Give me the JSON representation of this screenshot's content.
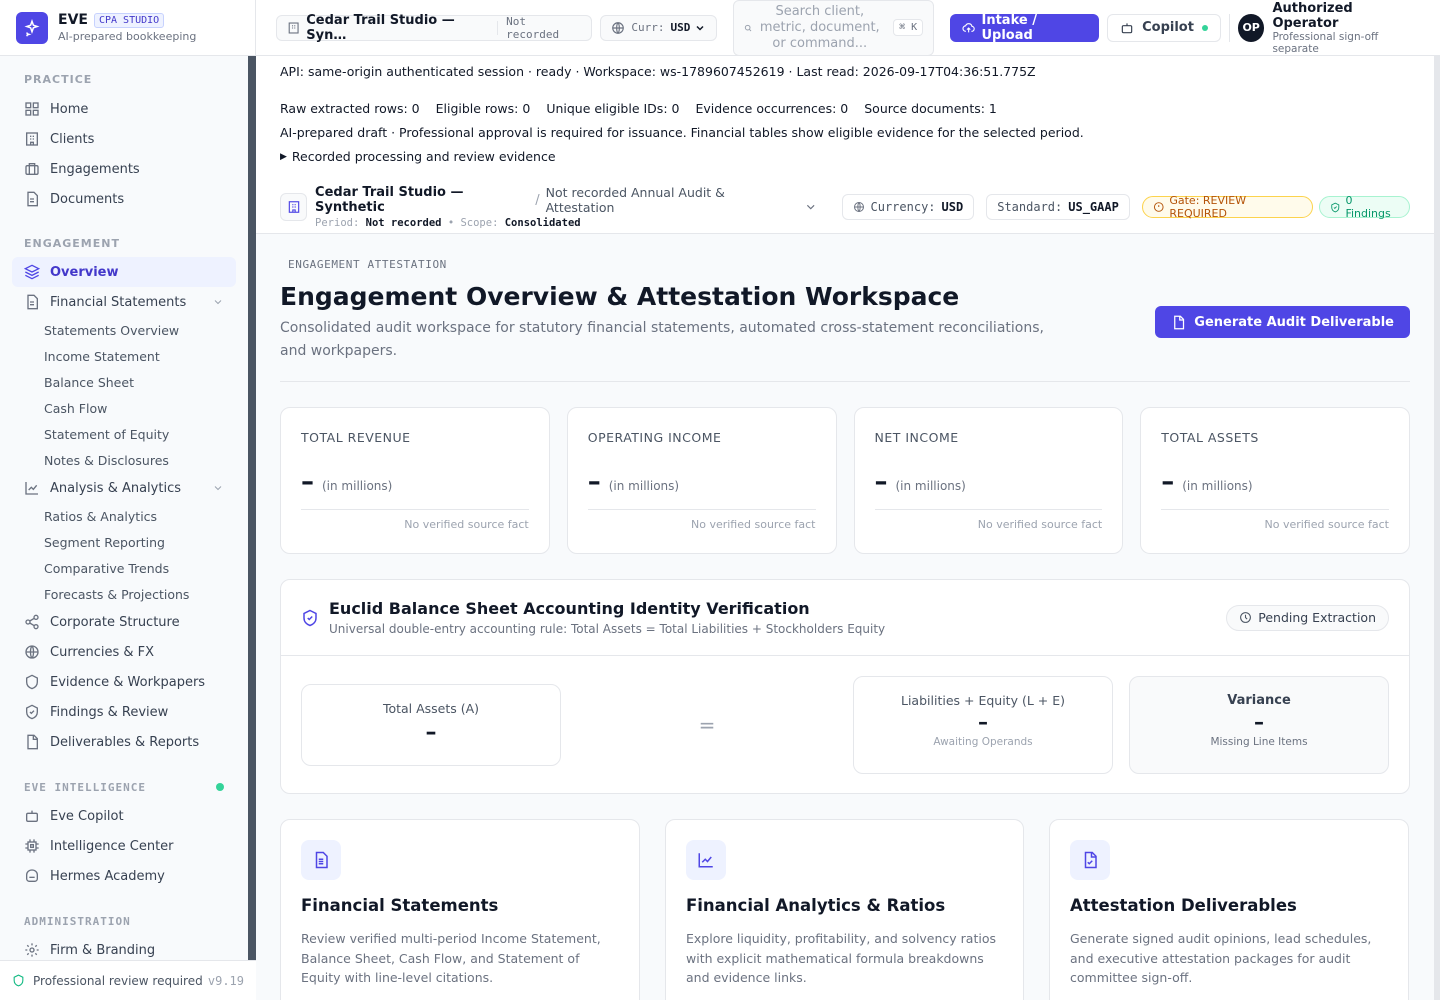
{
  "brand": {
    "name": "EVE",
    "badge": "CPA STUDIO",
    "tagline": "AI-prepared bookkeeping"
  },
  "sidebar": {
    "sections": {
      "practice": "PRACTICE",
      "engagement": "ENGAGEMENT",
      "intelligence": "EVE INTELLIGENCE",
      "admin": "ADMINISTRATION"
    },
    "practice": [
      {
        "label": "Home",
        "icon": "home-icon"
      },
      {
        "label": "Clients",
        "icon": "building-icon"
      },
      {
        "label": "Engagements",
        "icon": "briefcase-icon"
      },
      {
        "label": "Documents",
        "icon": "document-icon"
      }
    ],
    "engagement": {
      "overview": "Overview",
      "financial_statements": "Financial Statements",
      "fs_children": [
        "Statements Overview",
        "Income Statement",
        "Balance Sheet",
        "Cash Flow",
        "Statement of Equity",
        "Notes & Disclosures"
      ],
      "analysis": "Analysis & Analytics",
      "analysis_children": [
        "Ratios & Analytics",
        "Segment Reporting",
        "Comparative Trends",
        "Forecasts & Projections"
      ],
      "more": [
        {
          "label": "Corporate Structure",
          "icon": "share-icon"
        },
        {
          "label": "Currencies & FX",
          "icon": "globe-icon"
        },
        {
          "label": "Evidence & Workpapers",
          "icon": "shield-icon"
        },
        {
          "label": "Findings & Review",
          "icon": "shield-check-icon"
        },
        {
          "label": "Deliverables & Reports",
          "icon": "file-icon"
        }
      ]
    },
    "intelligence": [
      {
        "label": "Eve Copilot",
        "icon": "bot-icon"
      },
      {
        "label": "Intelligence Center",
        "icon": "cpu-icon"
      },
      {
        "label": "Hermes Academy",
        "icon": "academy-icon"
      }
    ],
    "admin": [
      {
        "label": "Firm & Branding",
        "icon": "gear-icon"
      }
    ],
    "footer": {
      "label": "Professional review required",
      "version": "v9.19"
    }
  },
  "topbar": {
    "client": "Cedar Trail Studio — Syn…",
    "client_status": "Not recorded",
    "currency_label": "Curr:",
    "currency_value": "USD",
    "search_placeholder": "Search client, metric, document, or command...",
    "search_kbd": "⌘ K",
    "intake_label": "Intake / Upload",
    "copilot_label": "Copilot",
    "user_initials": "OP",
    "user_name": "Authorized Operator",
    "user_role": "Professional sign-off separate"
  },
  "info": {
    "api": "API: same-origin authenticated session · ready · Workspace: ws-1789607452619 · Last read: 2026-09-17T04:36:51.775Z",
    "counts": [
      "Raw extracted rows: 0",
      "Eligible rows: 0",
      "Unique eligible IDs: 0",
      "Evidence occurrences: 0",
      "Source documents: 1"
    ],
    "draft_note": "AI-prepared draft · Professional approval is required for issuance. Financial tables show eligible evidence for the selected period.",
    "evidence_toggle": "Recorded processing and review evidence"
  },
  "context": {
    "client": "Cedar Trail Studio — Synthetic",
    "separator": "/",
    "engagement": "Not recorded Annual Audit & Attestation",
    "period_label": "Period:",
    "period_value": "Not recorded",
    "scope_label": "Scope:",
    "scope_value": "Consolidated",
    "currency_label": "Currency:",
    "currency_value": "USD",
    "standard_label": "Standard:",
    "standard_value": "US_GAAP",
    "gate": "Gate: REVIEW REQUIRED",
    "findings": "0 Findings"
  },
  "page": {
    "eyebrow": "ENGAGEMENT ATTESTATION",
    "title": "Engagement Overview & Attestation Workspace",
    "subtitle": "Consolidated audit workspace for statutory financial statements, automated cross-statement reconciliations, and workpapers.",
    "cta": "Generate Audit Deliverable"
  },
  "kpis": [
    {
      "label": "TOTAL REVENUE",
      "value": "–",
      "unit": "(in millions)",
      "foot": "No verified source fact"
    },
    {
      "label": "OPERATING INCOME",
      "value": "–",
      "unit": "(in millions)",
      "foot": "No verified source fact"
    },
    {
      "label": "NET INCOME",
      "value": "–",
      "unit": "(in millions)",
      "foot": "No verified source fact"
    },
    {
      "label": "TOTAL ASSETS",
      "value": "–",
      "unit": "(in millions)",
      "foot": "No verified source fact"
    }
  ],
  "identity": {
    "title": "Euclid Balance Sheet Accounting Identity Verification",
    "subtitle": "Universal double-entry accounting rule: Total Assets = Total Liabilities + Stockholders Equity",
    "status": "Pending Extraction",
    "assets_label": "Total Assets (A)",
    "assets_value": "–",
    "equals": "=",
    "le_label": "Liabilities + Equity (L + E)",
    "le_value": "–",
    "le_note": "Awaiting Operands",
    "variance_label": "Variance",
    "variance_value": "–",
    "variance_note": "Missing Line Items"
  },
  "features": [
    {
      "title": "Financial Statements",
      "desc": "Review verified multi-period Income Statement, Balance Sheet, Cash Flow, and Statement of Equity with line-level citations.",
      "icon": "statement-icon"
    },
    {
      "title": "Financial Analytics & Ratios",
      "desc": "Explore liquidity, profitability, and solvency ratios with explicit mathematical formula breakdowns and evidence links.",
      "icon": "chart-line-icon"
    },
    {
      "title": "Attestation Deliverables",
      "desc": "Generate signed audit opinions, lead schedules, and executive attestation packages for audit committee sign-off.",
      "icon": "file-check-icon"
    }
  ],
  "colors": {
    "accent": "#4f46e5",
    "gate": "#b45309",
    "findings": "#059669"
  }
}
